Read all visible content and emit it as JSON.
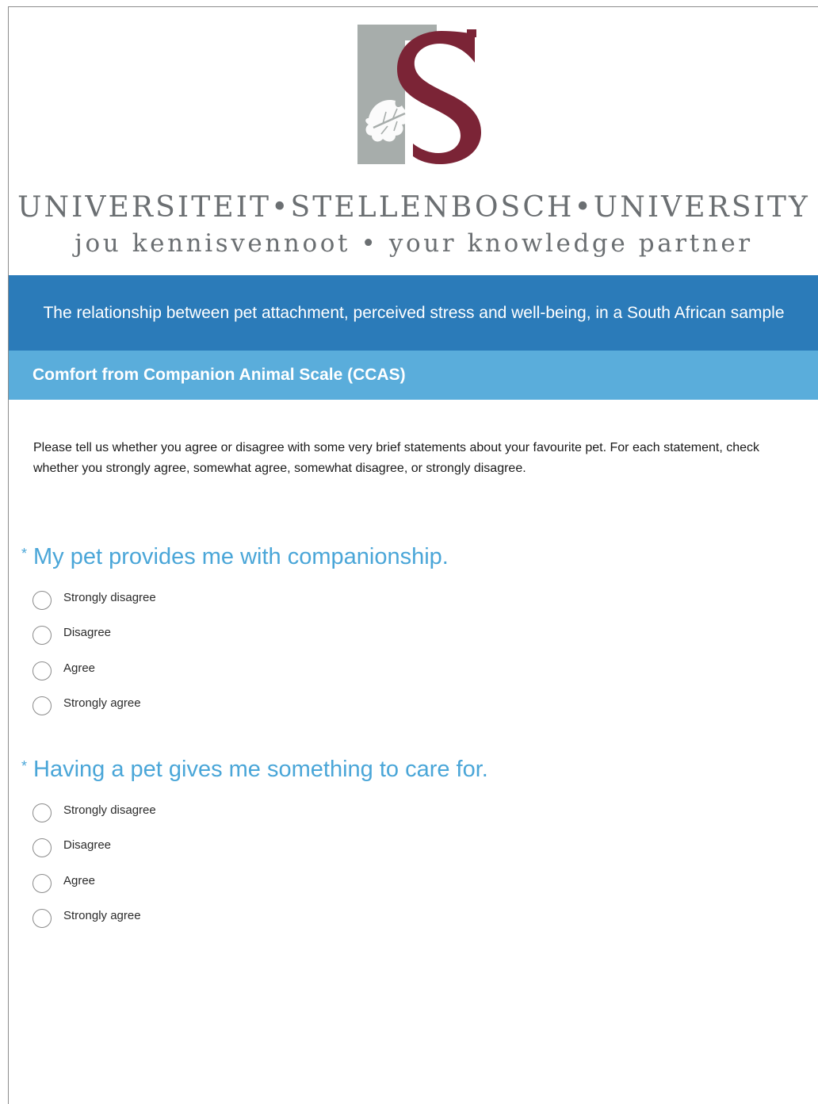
{
  "header": {
    "logo_icon": "stellenbosch-s-oakleaf-emblem-icon",
    "wordmark": "UNIVERSITEIT•STELLENBOSCH•UNIVERSITY",
    "tagline": "jou kennisvennoot • your knowledge partner"
  },
  "survey": {
    "title": "The relationship between pet attachment, perceived stress and well-being, in a South African sample",
    "section_title": "Comfort from Companion Animal Scale (CCAS)",
    "intro": "Please tell us whether you agree or disagree with some very brief statements about your favourite pet. For each statement, check whether you strongly agree, somewhat agree, somewhat disagree, or strongly disagree."
  },
  "questions": [
    {
      "required_marker": "*",
      "text": "My pet provides me with companionship.",
      "options": [
        "Strongly disagree",
        "Disagree",
        "Agree",
        "Strongly agree"
      ],
      "selected": null
    },
    {
      "required_marker": "*",
      "text": "Having a pet gives me something to care for.",
      "options": [
        "Strongly disagree",
        "Disagree",
        "Agree",
        "Strongly agree"
      ],
      "selected": null
    }
  ],
  "colors": {
    "title_bar": "#2b7bb9",
    "section_bar": "#5aaddb",
    "question_text": "#4aa6d8",
    "logo_gray": "#a7adab",
    "logo_maroon": "#7b2436"
  }
}
